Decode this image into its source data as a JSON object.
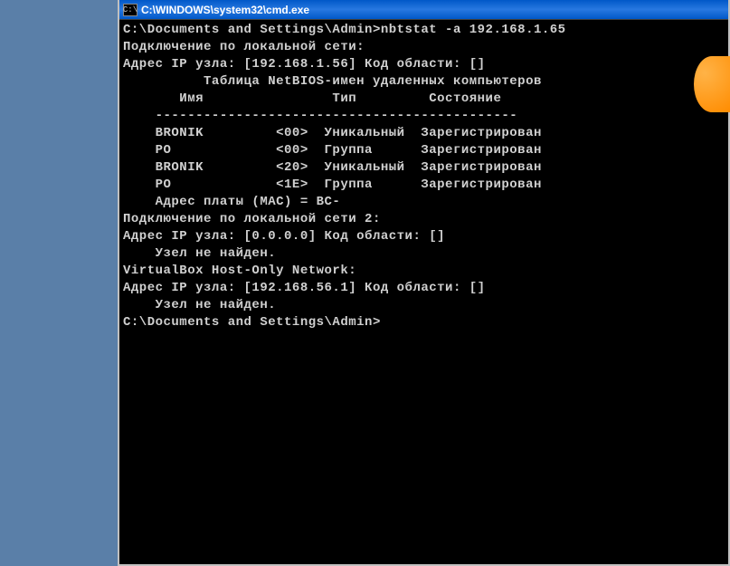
{
  "window": {
    "title": "C:\\WINDOWS\\system32\\cmd.exe",
    "icon_label": "cmd"
  },
  "output": {
    "prompt1": "C:\\Documents and Settings\\Admin>nbtstat -a 192.168.1.65",
    "blank": "",
    "conn1_header": "Подключение по локальной сети:",
    "conn1_ip": "Адрес IP узла: [192.168.1.56] Код области: []",
    "table_title": "          Таблица NetBIOS-имен удаленных компьютеров",
    "table_header": "       Имя                Тип         Состояние",
    "table_divider": "    ---------------------------------------------",
    "row1": "    BRONIK         <00>  Уникальный  Зарегистрирован",
    "row2": "    PO             <00>  Группа      Зарегистрирован",
    "row3": "    BRONIK         <20>  Уникальный  Зарегистрирован",
    "row4": "    PO             <1E>  Группа      Зарегистрирован",
    "mac_line_prefix": "    Адрес платы (MAC) = BC-",
    "conn2_header": "Подключение по локальной сети 2:",
    "conn2_ip": "Адрес IP узла: [0.0.0.0] Код области: []",
    "not_found": "    Узел не найден.",
    "conn3_header": "VirtualBox Host-Only Network:",
    "conn3_ip": "Адрес IP узла: [192.168.56.1] Код области: []",
    "prompt2": "C:\\Documents and Settings\\Admin>"
  }
}
